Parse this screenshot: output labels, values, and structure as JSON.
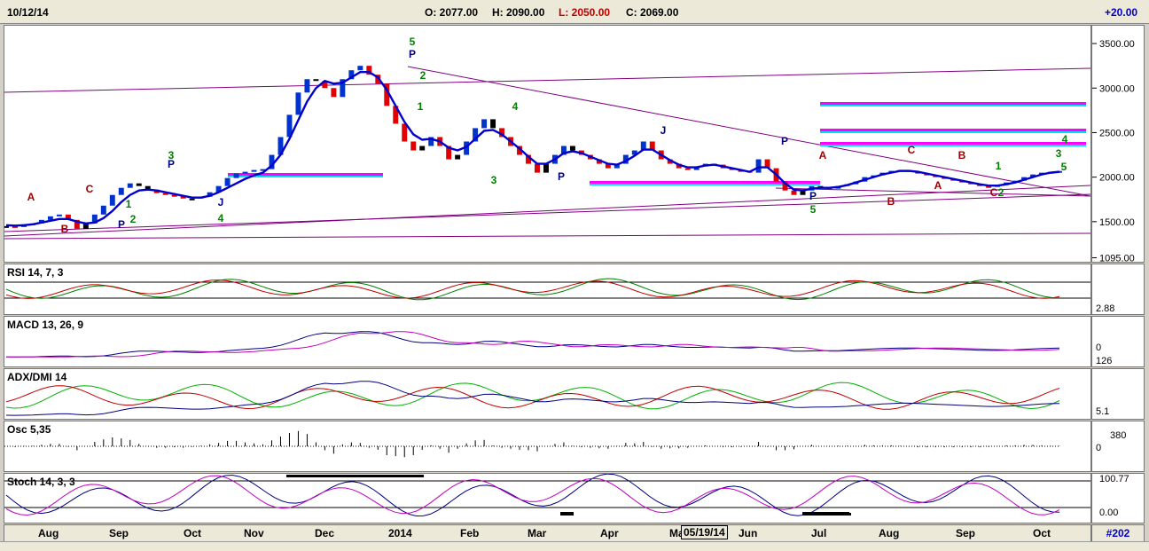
{
  "header": {
    "date": "10/12/14",
    "open": "O: 2077.00",
    "high": "H: 2090.00",
    "low": "L: 2050.00",
    "close": "C: 2069.00",
    "change": "+20.00"
  },
  "timeline": {
    "months": [
      "Aug",
      "Sep",
      "Oct",
      "Nov",
      "Dec",
      "2014",
      "Feb",
      "Mar",
      "Apr",
      "Ma",
      "Jun",
      "Jul",
      "Aug",
      "Sep",
      "Oct"
    ],
    "cursor_date": "05/19/14",
    "bar_count": "#202"
  },
  "chart_data": {
    "type": "line",
    "title": "",
    "ylim": [
      1050,
      3700
    ],
    "yticks": [
      "3500.00",
      "3000.00",
      "2500.00",
      "2000.00",
      "1500.00",
      "1095.00",
      "1000"
    ],
    "price": [
      1450,
      1440,
      1470,
      1480,
      1520,
      1560,
      1580,
      1520,
      1420,
      1480,
      1580,
      1680,
      1800,
      1880,
      1930,
      1900,
      1860,
      1820,
      1800,
      1790,
      1760,
      1760,
      1780,
      1830,
      1900,
      1990,
      2040,
      2060,
      2080,
      2090,
      2250,
      2450,
      2700,
      2950,
      3100,
      3080,
      3000,
      2900,
      3100,
      3200,
      3250,
      3150,
      3050,
      2800,
      2600,
      2400,
      2300,
      2350,
      2450,
      2350,
      2200,
      2250,
      2400,
      2550,
      2650,
      2550,
      2450,
      2350,
      2250,
      2150,
      2050,
      2150,
      2250,
      2350,
      2300,
      2250,
      2200,
      2150,
      2100,
      2150,
      2250,
      2300,
      2400,
      2300,
      2200,
      2150,
      2100,
      2080,
      2120,
      2150,
      2140,
      2100,
      2080,
      2070,
      2050,
      2200,
      2100,
      1950,
      1850,
      1800,
      1850,
      1900,
      1880,
      1870,
      1900,
      1920,
      1950,
      2000,
      2020,
      2050,
      2070,
      2080,
      2060,
      2040,
      2020,
      2000,
      1980,
      1960,
      1940,
      1920,
      1900,
      1890,
      1910,
      1940,
      1960,
      2000,
      2030,
      2050,
      2060,
      2069
    ],
    "ma": [
      1460,
      1455,
      1460,
      1470,
      1490,
      1510,
      1530,
      1530,
      1500,
      1480,
      1490,
      1540,
      1620,
      1720,
      1800,
      1850,
      1860,
      1850,
      1830,
      1810,
      1790,
      1770,
      1770,
      1790,
      1830,
      1880,
      1930,
      1980,
      2020,
      2050,
      2130,
      2250,
      2430,
      2640,
      2850,
      3000,
      3080,
      3050,
      3060,
      3120,
      3180,
      3180,
      3120,
      2980,
      2800,
      2620,
      2480,
      2420,
      2430,
      2400,
      2330,
      2300,
      2340,
      2430,
      2520,
      2530,
      2480,
      2400,
      2320,
      2230,
      2150,
      2150,
      2200,
      2270,
      2290,
      2270,
      2230,
      2190,
      2150,
      2140,
      2180,
      2240,
      2310,
      2310,
      2250,
      2190,
      2140,
      2110,
      2110,
      2130,
      2140,
      2120,
      2100,
      2080,
      2060,
      2110,
      2110,
      2030,
      1930,
      1860,
      1850,
      1870,
      1880,
      1880,
      1890,
      1910,
      1940,
      1970,
      2000,
      2030,
      2050,
      2070,
      2070,
      2060,
      2040,
      2020,
      2000,
      1980,
      1960,
      1940,
      1920,
      1905,
      1905,
      1920,
      1940,
      1970,
      2000,
      2030,
      2050,
      2060
    ],
    "wave_labels": [
      "A",
      "B",
      "C",
      "1",
      "2",
      "P",
      "3",
      "P",
      "J",
      "4",
      "5",
      "P",
      "2",
      "1",
      "3",
      "4",
      "P",
      "J",
      "P",
      "5",
      "P",
      "A",
      "B",
      "C",
      "A",
      "B",
      "1",
      "2",
      "C",
      "3",
      "4",
      "5"
    ],
    "annotation_values": [],
    "indicators": [
      {
        "name": "RSI 14, 7, 3",
        "labels": [
          "2.88"
        ]
      },
      {
        "name": "MACD 13, 26, 9",
        "labels": [
          "0",
          "126"
        ]
      },
      {
        "name": "ADX/DMI 14",
        "labels": [
          "5.1"
        ]
      },
      {
        "name": "Osc 5,35",
        "labels": [
          "380",
          "0"
        ]
      },
      {
        "name": "Stoch 14, 3, 3",
        "labels": [
          "100.77",
          "0.00"
        ]
      }
    ]
  }
}
